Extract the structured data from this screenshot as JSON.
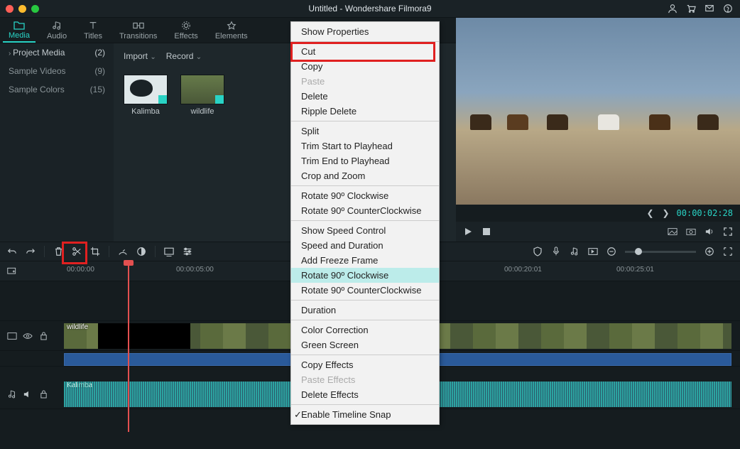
{
  "title": "Untitled - Wondershare Filmora9",
  "tabs": [
    "Media",
    "Audio",
    "Titles",
    "Transitions",
    "Effects",
    "Elements"
  ],
  "sidebar": {
    "header": "Project Media",
    "header_count": "(2)",
    "items": [
      {
        "label": "Sample Videos",
        "count": "(9)"
      },
      {
        "label": "Sample Colors",
        "count": "(15)"
      }
    ]
  },
  "media_toolbar": {
    "import": "Import",
    "record": "Record"
  },
  "thumbs": [
    {
      "label": "Kalimba"
    },
    {
      "label": "wildlife"
    }
  ],
  "preview": {
    "time": "00:00:02:28"
  },
  "timeline_marks": [
    "00:00:00",
    "00:00:05:00",
    "00:00:20:01",
    "00:00:25:01"
  ],
  "tracks": {
    "video_clip_label": "wildlife",
    "audio_clip_label": "Kalimba"
  },
  "context_menu": {
    "groups": [
      [
        {
          "l": "Show Properties"
        }
      ],
      [
        {
          "l": "Cut"
        },
        {
          "l": "Copy"
        },
        {
          "l": "Paste",
          "disabled": true
        },
        {
          "l": "Delete"
        },
        {
          "l": "Ripple Delete"
        }
      ],
      [
        {
          "l": "Split"
        },
        {
          "l": "Trim Start to Playhead"
        },
        {
          "l": "Trim End to Playhead"
        },
        {
          "l": "Crop and Zoom"
        }
      ],
      [
        {
          "l": "Rotate 90º Clockwise"
        },
        {
          "l": "Rotate 90º CounterClockwise"
        }
      ],
      [
        {
          "l": "Show Speed Control"
        },
        {
          "l": "Speed and Duration"
        },
        {
          "l": "Add Freeze Frame"
        },
        {
          "l": "Rotate 90º Clockwise",
          "hl": true
        },
        {
          "l": "Rotate 90º CounterClockwise"
        }
      ],
      [
        {
          "l": "Duration"
        }
      ],
      [
        {
          "l": "Color Correction"
        },
        {
          "l": "Green Screen"
        }
      ],
      [
        {
          "l": "Copy Effects"
        },
        {
          "l": "Paste Effects",
          "disabled": true
        },
        {
          "l": "Delete Effects"
        }
      ],
      [
        {
          "l": "Enable Timeline Snap",
          "checked": true
        }
      ]
    ]
  }
}
